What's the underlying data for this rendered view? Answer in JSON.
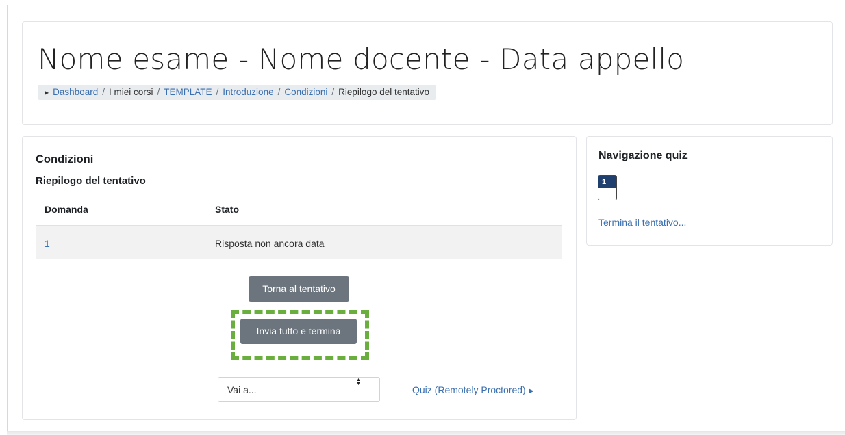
{
  "header": {
    "title": "Nome esame - Nome docente - Data appello",
    "breadcrumb": [
      {
        "label": "Dashboard"
      },
      {
        "label": "I miei corsi"
      },
      {
        "label": "TEMPLATE"
      },
      {
        "label": "Introduzione"
      },
      {
        "label": "Condizioni"
      },
      {
        "label": "Riepilogo del tentativo"
      }
    ]
  },
  "main": {
    "section_title": "Condizioni",
    "subtitle": "Riepilogo del tentativo",
    "table": {
      "columns": [
        "Domanda",
        "Stato"
      ],
      "rows": [
        {
          "question": "1",
          "status": "Risposta non ancora data"
        }
      ]
    },
    "back_button": "Torna al tentativo",
    "submit_button": "Invia tutto e termina",
    "highlight_color": "#6aae3d",
    "jump_select": {
      "selected": "Vai a..."
    },
    "next_link": "Quiz (Remotely Proctored)"
  },
  "quiz_nav": {
    "title": "Navigazione quiz",
    "question_button": "1",
    "finish_link": "Termina il tentativo..."
  }
}
